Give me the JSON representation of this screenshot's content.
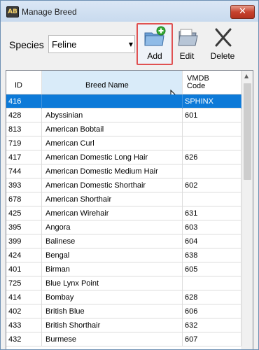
{
  "window": {
    "title": "Manage Breed",
    "close_glyph": "✕",
    "app_icon_text": "AB"
  },
  "toolbar": {
    "species_label": "Species",
    "species_value": "Feline",
    "dropdown_glyph": "▼",
    "add_label": "Add",
    "edit_label": "Edit",
    "delete_label": "Delete",
    "icons": {
      "add": "folder-add-icon",
      "edit": "folder-edit-icon",
      "delete": "x-delete-icon"
    }
  },
  "grid": {
    "columns": {
      "id": "ID",
      "breed": "Breed Name",
      "code_line1": "VMDB",
      "code_line2": "Code"
    },
    "selected_row": 0,
    "scroll_up_glyph": "▲",
    "rows": [
      {
        "id": "416",
        "breed": "",
        "code": "SPHINX"
      },
      {
        "id": "428",
        "breed": "Abyssinian",
        "code": "601"
      },
      {
        "id": "813",
        "breed": "American Bobtail",
        "code": ""
      },
      {
        "id": "719",
        "breed": "American Curl",
        "code": ""
      },
      {
        "id": "417",
        "breed": "American Domestic Long Hair",
        "code": "626"
      },
      {
        "id": "744",
        "breed": "American Domestic Medium Hair",
        "code": ""
      },
      {
        "id": "393",
        "breed": "American Domestic Shorthair",
        "code": "602"
      },
      {
        "id": "678",
        "breed": "American Shorthair",
        "code": ""
      },
      {
        "id": "425",
        "breed": "American Wirehair",
        "code": "631"
      },
      {
        "id": "395",
        "breed": "Angora",
        "code": "603"
      },
      {
        "id": "399",
        "breed": "Balinese",
        "code": "604"
      },
      {
        "id": "424",
        "breed": "Bengal",
        "code": "638"
      },
      {
        "id": "401",
        "breed": "Birman",
        "code": "605"
      },
      {
        "id": "725",
        "breed": "Blue Lynx Point",
        "code": ""
      },
      {
        "id": "414",
        "breed": "Bombay",
        "code": "628"
      },
      {
        "id": "402",
        "breed": "British Blue",
        "code": "606"
      },
      {
        "id": "433",
        "breed": "British Shorthair",
        "code": "632"
      },
      {
        "id": "432",
        "breed": "Burmese",
        "code": "607"
      }
    ]
  },
  "colors": {
    "selection": "#0d7ad8",
    "header_highlight": "#d9ebf9",
    "add_highlight_border": "#e05252"
  }
}
